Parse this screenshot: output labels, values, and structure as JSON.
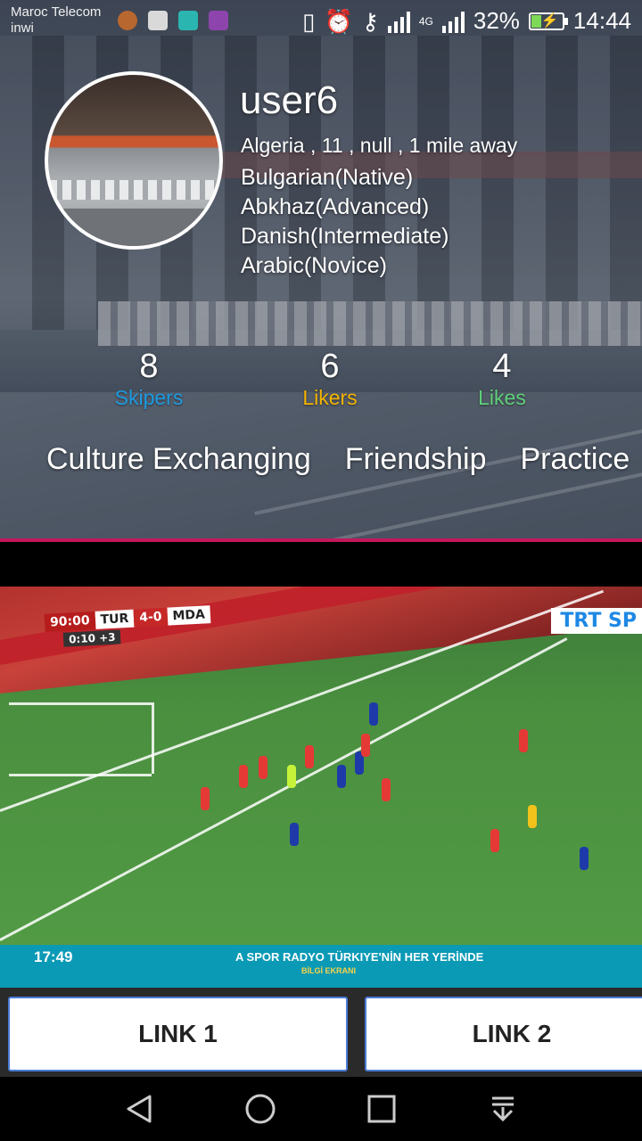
{
  "status_bar": {
    "carrier_line1": "Maroc Telecom",
    "carrier_line2": "inwi",
    "network": "4G",
    "battery": "32%",
    "time": "14:44"
  },
  "profile": {
    "username": "user6",
    "location_line": "Algeria , 11 , null , 1 mile away",
    "languages": [
      "Bulgarian(Native)",
      "Abkhaz(Advanced)",
      "Danish(Intermediate)",
      "Arabic(Novice)"
    ]
  },
  "stats": [
    {
      "value": "8",
      "label": "Skipers",
      "color": "#1e9be0"
    },
    {
      "value": "6",
      "label": "Likers",
      "color": "#f4b400"
    },
    {
      "value": "4",
      "label": "Likes",
      "color": "#5fd07a"
    }
  ],
  "interests": [
    "Culture Exchanging",
    "Friendship",
    "Practice"
  ],
  "video": {
    "scoreboard_time": "90:00",
    "team_home": "TUR",
    "score": "4-0",
    "team_away": "MDA",
    "added_time": "0:10  +3",
    "channel": "TRT SP",
    "clock": "17:49",
    "ticker": "A SPOR RADYO TÜRKIYE'NİN HER YERİNDE",
    "ticker_sub": "BİLGİ EKRANI"
  },
  "links": [
    "LINK 1",
    "LINK 2"
  ],
  "nav": {
    "back": "back-icon",
    "home": "home-icon",
    "recents": "recents-icon",
    "notifications": "notification-shade-icon"
  }
}
